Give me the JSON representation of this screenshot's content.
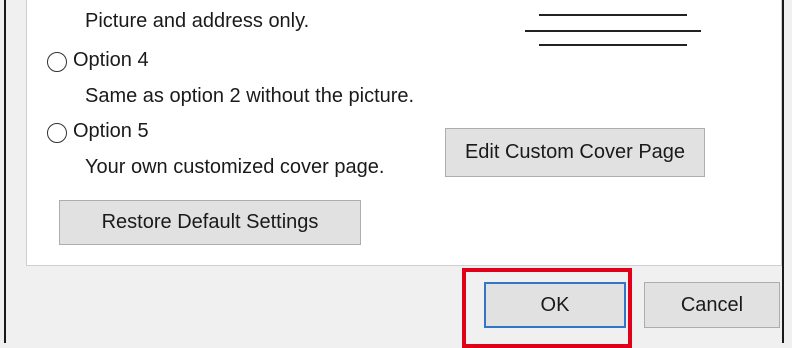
{
  "dialog": {
    "option3": {
      "description": "Picture and address only."
    },
    "option4": {
      "label": "Option 4",
      "description": "Same as option 2 without the picture."
    },
    "option5": {
      "label": "Option 5",
      "description": "Your own customized cover page."
    },
    "edit_custom_button": "Edit Custom Cover Page",
    "restore_defaults_button": "Restore Default Settings",
    "ok_button": "OK",
    "cancel_button": "Cancel"
  },
  "colors": {
    "highlight": "#e0001a",
    "default_button_border": "#3277c7"
  }
}
